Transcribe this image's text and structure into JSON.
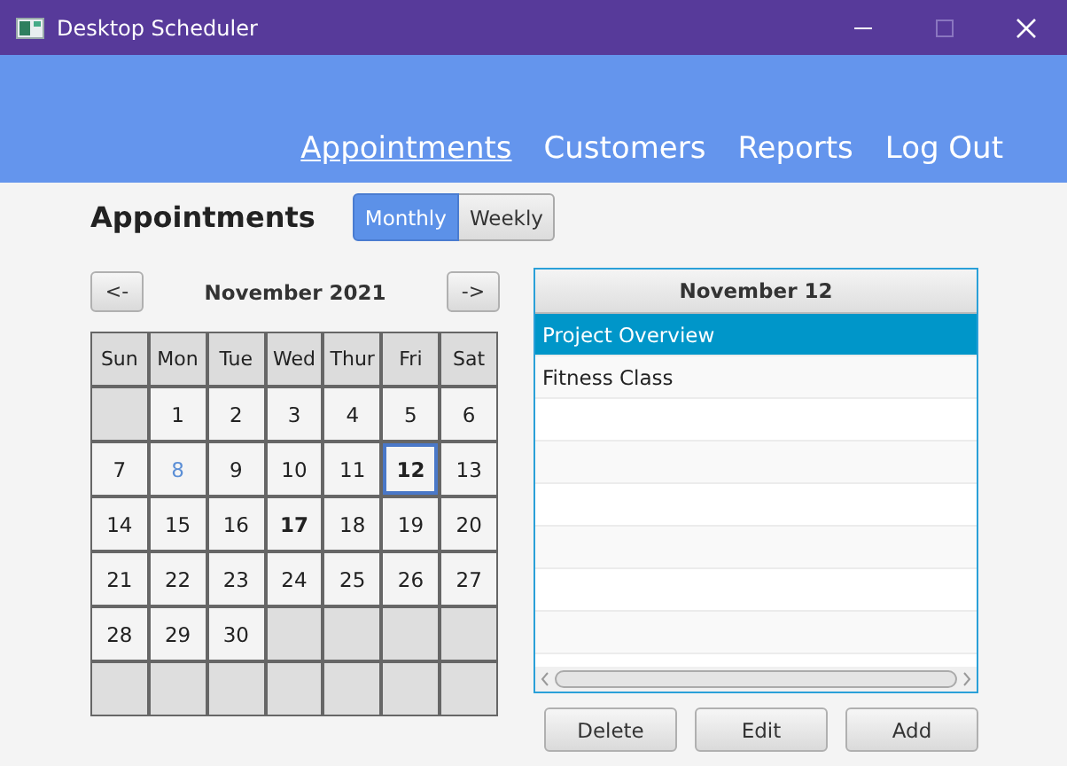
{
  "window": {
    "title": "Desktop Scheduler"
  },
  "nav": [
    {
      "label": "Appointments",
      "selected": true
    },
    {
      "label": "Customers",
      "selected": false
    },
    {
      "label": "Reports",
      "selected": false
    },
    {
      "label": "Log Out",
      "selected": false
    }
  ],
  "heading": "Appointments",
  "view_toggle": [
    {
      "label": "Monthly",
      "selected": true
    },
    {
      "label": "Weekly",
      "selected": false
    }
  ],
  "calendar": {
    "prev": "<-",
    "month": "November 2021",
    "next": "->",
    "weekdays": [
      "Sun",
      "Mon",
      "Tue",
      "Wed",
      "Thur",
      "Fri",
      "Sat"
    ],
    "weeks": [
      [
        {
          "kind": "blank"
        },
        {
          "kind": "day",
          "label": "1",
          "selected": false,
          "bold": false,
          "today": false
        },
        {
          "kind": "day",
          "label": "2",
          "selected": false,
          "bold": false,
          "today": false
        },
        {
          "kind": "day",
          "label": "3",
          "selected": false,
          "bold": false,
          "today": false
        },
        {
          "kind": "day",
          "label": "4",
          "selected": false,
          "bold": false,
          "today": false
        },
        {
          "kind": "day",
          "label": "5",
          "selected": false,
          "bold": false,
          "today": false
        },
        {
          "kind": "day",
          "label": "6",
          "selected": false,
          "bold": false,
          "today": false
        }
      ],
      [
        {
          "kind": "day",
          "label": "7",
          "selected": false,
          "bold": false,
          "today": false
        },
        {
          "kind": "day",
          "label": "8",
          "selected": false,
          "bold": false,
          "today": true
        },
        {
          "kind": "day",
          "label": "9",
          "selected": false,
          "bold": false,
          "today": false
        },
        {
          "kind": "day",
          "label": "10",
          "selected": false,
          "bold": false,
          "today": false
        },
        {
          "kind": "day",
          "label": "11",
          "selected": false,
          "bold": false,
          "today": false
        },
        {
          "kind": "day",
          "label": "12",
          "selected": true,
          "bold": true,
          "today": false
        },
        {
          "kind": "day",
          "label": "13",
          "selected": false,
          "bold": false,
          "today": false
        }
      ],
      [
        {
          "kind": "day",
          "label": "14",
          "selected": false,
          "bold": false,
          "today": false
        },
        {
          "kind": "day",
          "label": "15",
          "selected": false,
          "bold": false,
          "today": false
        },
        {
          "kind": "day",
          "label": "16",
          "selected": false,
          "bold": false,
          "today": false
        },
        {
          "kind": "day",
          "label": "17",
          "selected": false,
          "bold": true,
          "today": false
        },
        {
          "kind": "day",
          "label": "18",
          "selected": false,
          "bold": false,
          "today": false
        },
        {
          "kind": "day",
          "label": "19",
          "selected": false,
          "bold": false,
          "today": false
        },
        {
          "kind": "day",
          "label": "20",
          "selected": false,
          "bold": false,
          "today": false
        }
      ],
      [
        {
          "kind": "day",
          "label": "21",
          "selected": false,
          "bold": false,
          "today": false
        },
        {
          "kind": "day",
          "label": "22",
          "selected": false,
          "bold": false,
          "today": false
        },
        {
          "kind": "day",
          "label": "23",
          "selected": false,
          "bold": false,
          "today": false
        },
        {
          "kind": "day",
          "label": "24",
          "selected": false,
          "bold": false,
          "today": false
        },
        {
          "kind": "day",
          "label": "25",
          "selected": false,
          "bold": false,
          "today": false
        },
        {
          "kind": "day",
          "label": "26",
          "selected": false,
          "bold": false,
          "today": false
        },
        {
          "kind": "day",
          "label": "27",
          "selected": false,
          "bold": false,
          "today": false
        }
      ],
      [
        {
          "kind": "day",
          "label": "28",
          "selected": false,
          "bold": false,
          "today": false
        },
        {
          "kind": "day",
          "label": "29",
          "selected": false,
          "bold": false,
          "today": false
        },
        {
          "kind": "day",
          "label": "30",
          "selected": false,
          "bold": false,
          "today": false
        },
        {
          "kind": "blank"
        },
        {
          "kind": "blank"
        },
        {
          "kind": "blank"
        },
        {
          "kind": "blank"
        }
      ],
      [
        {
          "kind": "blank"
        },
        {
          "kind": "blank"
        },
        {
          "kind": "blank"
        },
        {
          "kind": "blank"
        },
        {
          "kind": "blank"
        },
        {
          "kind": "blank"
        },
        {
          "kind": "blank"
        }
      ]
    ]
  },
  "appointments": {
    "title": "November 12",
    "items": [
      {
        "label": "Project Overview",
        "selected": true
      },
      {
        "label": "Fitness Class",
        "selected": false
      }
    ]
  },
  "buttons": [
    "Delete",
    "Edit",
    "Add"
  ]
}
